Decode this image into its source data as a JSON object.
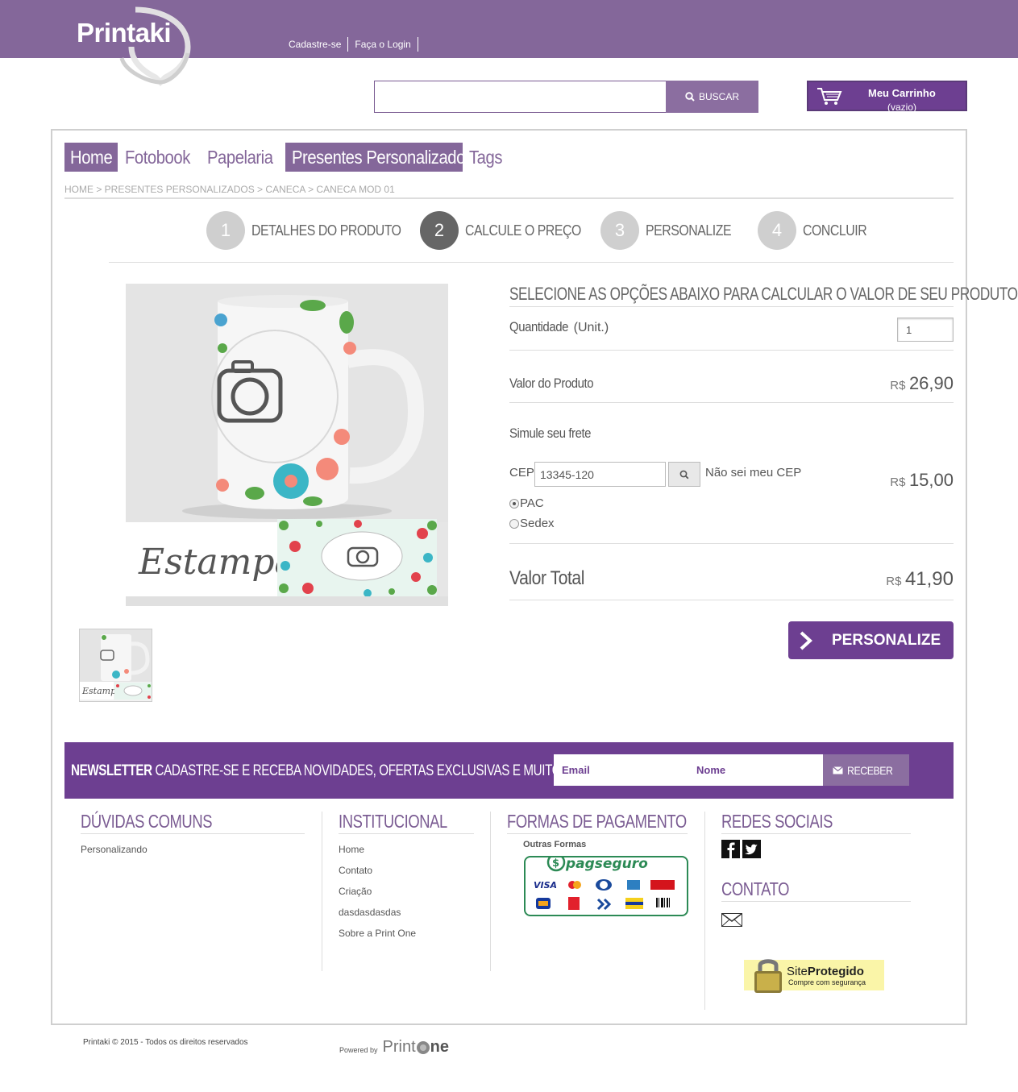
{
  "header": {
    "logo_text": "Printaki",
    "links": [
      "Cadastre-se",
      "Faça o Login"
    ],
    "search_button": "BUSCAR",
    "cart_title": "Meu Carrinho",
    "cart_status": "(vazio)"
  },
  "nav": {
    "items": [
      {
        "label": "Home",
        "active": true
      },
      {
        "label": "Fotobook",
        "active": false
      },
      {
        "label": "Papelaria",
        "active": false
      },
      {
        "label": "Presentes Personalizados",
        "active": true
      },
      {
        "label": "Tags",
        "active": false
      }
    ]
  },
  "breadcrumb": "HOME > PRESENTES PERSONALIZADOS > CANECA > CANECA MOD 01",
  "steps": [
    {
      "num": "1",
      "label": "DETALHES DO PRODUTO",
      "active": false
    },
    {
      "num": "2",
      "label": "CALCULE O PREÇO",
      "active": true
    },
    {
      "num": "3",
      "label": "PERSONALIZE",
      "active": false
    },
    {
      "num": "4",
      "label": "CONCLUIR",
      "active": false
    }
  ],
  "product": {
    "image_caption": "Estampa",
    "thumb_caption": "Estampa"
  },
  "calc": {
    "title": "SELECIONE AS OPÇÕES ABAIXO PARA CALCULAR O VALOR DE SEU PRODUTO",
    "quantity_label": "Quantidade",
    "quantity_unit": "(Unit.)",
    "quantity_value": "1",
    "product_value_label": "Valor do Produto",
    "currency": "R$",
    "product_value": "26,90",
    "shipping_label": "Simule seu frete",
    "cep_label": "CEP",
    "cep_value": "13345-120",
    "cep_unknown": "Não sei meu CEP",
    "shipping_value": "15,00",
    "shipping_options": [
      {
        "label": "PAC",
        "selected": true
      },
      {
        "label": "Sedex",
        "selected": false
      }
    ],
    "total_label": "Valor Total",
    "total_value": "41,90",
    "personalize_button": "PERSONALIZE"
  },
  "newsletter": {
    "title_bold": "NEWSLETTER",
    "title_rest": "CADASTRE-SE E RECEBA NOVIDADES, OFERTAS EXCLUSIVAS E MUITO MAIS",
    "email_placeholder": "Email",
    "name_placeholder": "Nome",
    "button": "RECEBER"
  },
  "footer": {
    "faq_title": "DÚVIDAS COMUNS",
    "faq_links": [
      "Personalizando"
    ],
    "inst_title": "INSTITUCIONAL",
    "inst_links": [
      "Home",
      "Contato",
      "Criação",
      "dasdasdasdas",
      "Sobre a Print One"
    ],
    "pay_title": "FORMAS DE PAGAMENTO",
    "pay_subtitle": "Outras Formas",
    "pagseguro_text": "pagseguro",
    "social_title": "REDES SOCIAIS",
    "contact_title": "CONTATO",
    "site_protegido_1": "Site",
    "site_protegido_2": "Protegido",
    "site_protegido_sub": "Compre com segurança",
    "copyright": "Printaki © 2015 - Todos os direitos reservados",
    "powered_by": "Powered by",
    "powered_brand_a": "Print",
    "powered_brand_b": "ne"
  },
  "colors": {
    "brand_purple": "#84679a",
    "dark_purple": "#6d3f91",
    "button_purple": "#8b6ea0"
  }
}
